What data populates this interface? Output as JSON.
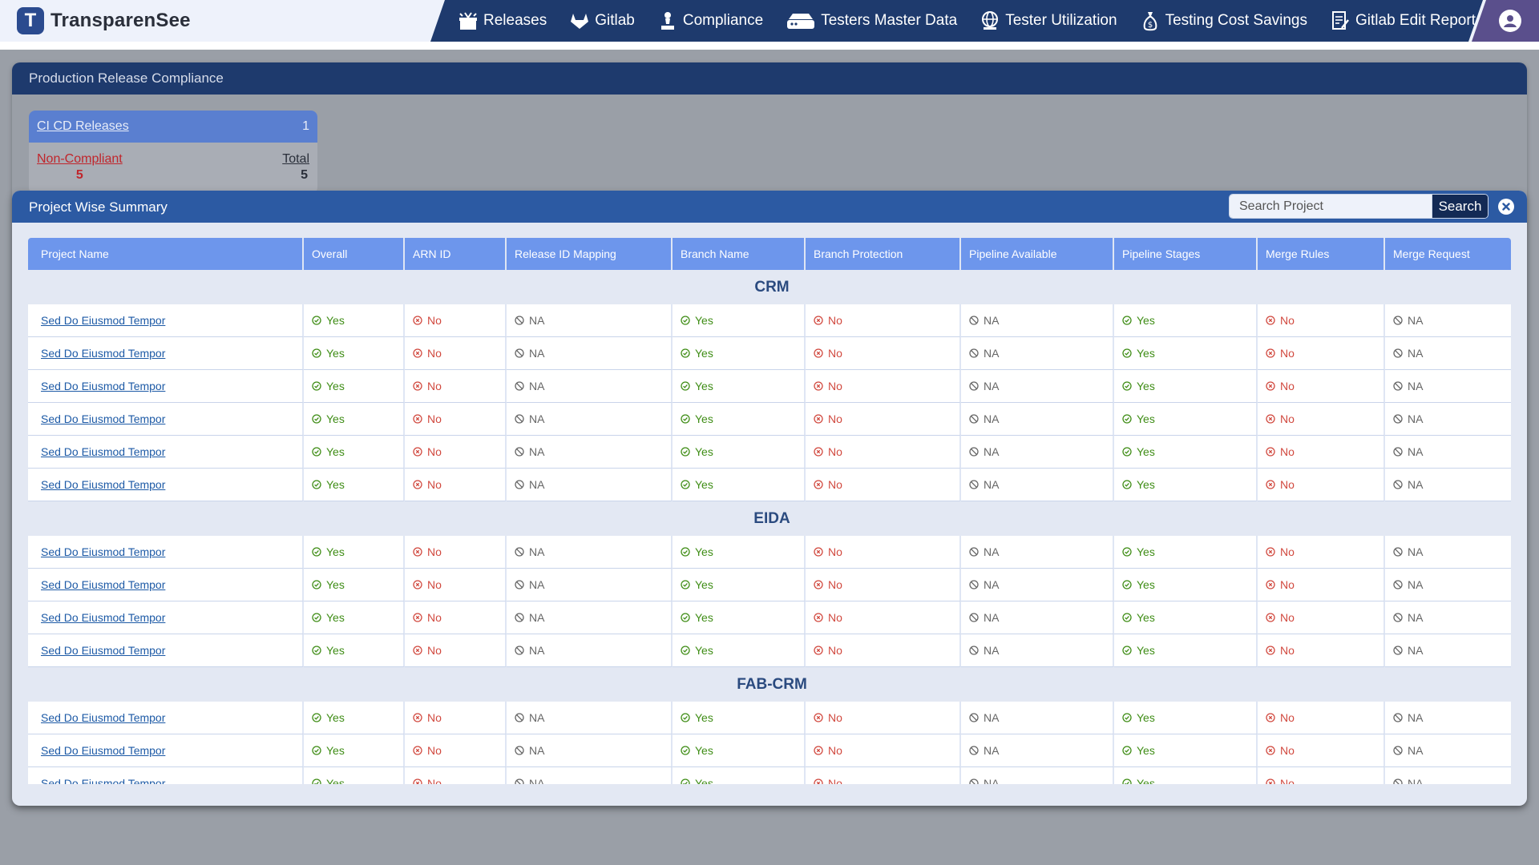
{
  "app": {
    "name": "TransparenSee",
    "logo_letter": "T"
  },
  "nav": [
    {
      "label": "Releases",
      "icon": "releases-icon"
    },
    {
      "label": "Gitlab",
      "icon": "gitlab-icon"
    },
    {
      "label": "Compliance",
      "icon": "compliance-icon"
    },
    {
      "label": "Testers Master Data",
      "icon": "server-icon"
    },
    {
      "label": "Tester Utilization",
      "icon": "globe-icon"
    },
    {
      "label": "Testing Cost Savings",
      "icon": "money-bag-icon"
    },
    {
      "label": "Gitlab Edit Report",
      "icon": "edit-report-icon"
    }
  ],
  "panel": {
    "title": "Production Release Compliance",
    "card": {
      "title": "CI CD Releases",
      "count": "1",
      "non_compliant_label": "Non-Compliant",
      "non_compliant_value": "5",
      "total_label": "Total",
      "total_value": "5"
    }
  },
  "modal": {
    "title": "Project Wise Summary",
    "search_placeholder": "Search Project",
    "search_button": "Search",
    "columns": [
      "Project Name",
      "Overall",
      "ARN ID",
      "Release ID Mapping",
      "Branch Name",
      "Branch Protection",
      "Pipeline Available",
      "Pipeline Stages",
      "Merge Rules",
      "Merge Request"
    ],
    "row_statuses": [
      "Yes",
      "No",
      "NA",
      "Yes",
      "No",
      "NA",
      "Yes",
      "No",
      "NA"
    ],
    "groups": [
      {
        "name": "CRM",
        "rows": [
          "Sed Do Eiusmod Tempor",
          "Sed Do Eiusmod Tempor",
          "Sed Do Eiusmod Tempor",
          "Sed Do Eiusmod Tempor",
          "Sed Do Eiusmod Tempor",
          "Sed Do Eiusmod Tempor"
        ]
      },
      {
        "name": "EIDA",
        "rows": [
          "Sed Do Eiusmod Tempor",
          "Sed Do Eiusmod Tempor",
          "Sed Do Eiusmod Tempor",
          "Sed Do Eiusmod Tempor"
        ]
      },
      {
        "name": "FAB-CRM",
        "rows": [
          "Sed Do Eiusmod Tempor",
          "Sed Do Eiusmod Tempor",
          "Sed Do Eiusmod Tempor"
        ]
      }
    ]
  },
  "colors": {
    "nav_bg": "#1e3a6d",
    "modal_header": "#2c5aa3",
    "table_header": "#6d96ec",
    "yes": "#3f8d16",
    "no": "#d1493f",
    "na": "#666666",
    "link": "#1d5aa6"
  }
}
